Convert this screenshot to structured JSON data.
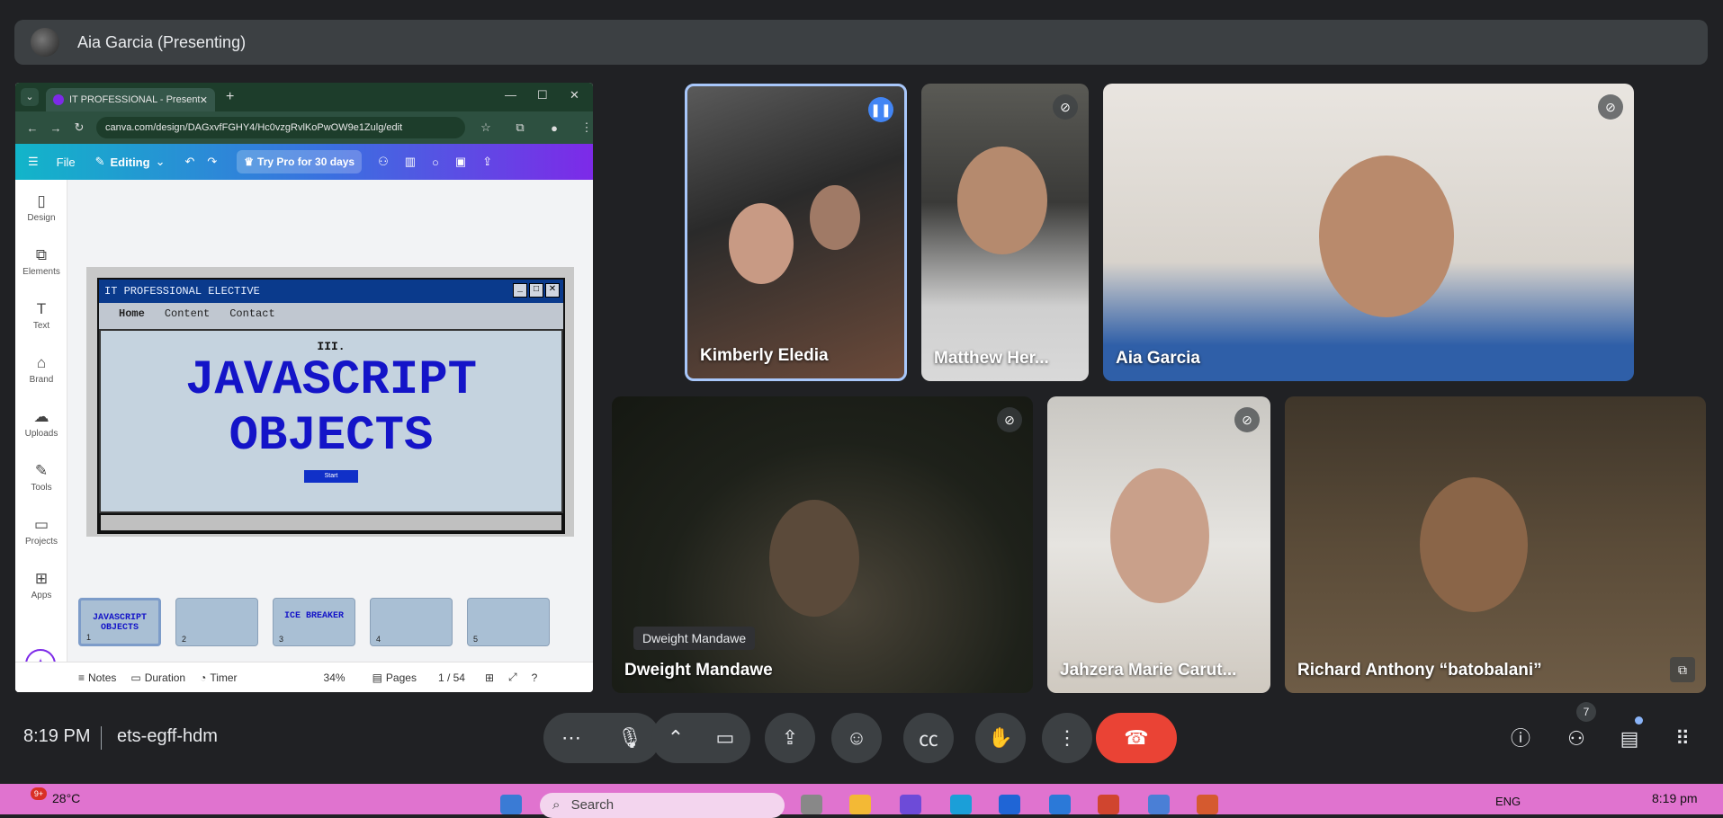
{
  "header": {
    "presenter_title": "Aia Garcia (Presenting)"
  },
  "shared_screen": {
    "browser": {
      "tab_title": "IT PROFESSIONAL - Presentatio",
      "url": "canva.com/design/DAGxvfFGHY4/Hc0vzgRvlKoPwOW9e1Zulg/edit"
    },
    "canva": {
      "file_label": "File",
      "editing_label": "Editing",
      "pro_button": "Try Pro for 30 days",
      "sidebar": [
        "Design",
        "Elements",
        "Text",
        "Brand",
        "Uploads",
        "Tools",
        "Projects",
        "Apps"
      ],
      "slide": {
        "window_title": "IT PROFESSIONAL ELECTIVE",
        "menu": [
          "Home",
          "Content",
          "Contact"
        ],
        "number": "III.",
        "line1": "JAVASCRIPT",
        "line2": "OBJECTS",
        "start": "Start"
      },
      "thumbnails": [
        {
          "n": "1",
          "text": "JAVASCRIPT OBJECTS"
        },
        {
          "n": "2",
          "text": ""
        },
        {
          "n": "3",
          "text": "ICE BREAKER"
        },
        {
          "n": "4",
          "text": ""
        },
        {
          "n": "5",
          "text": ""
        }
      ],
      "bottom": {
        "notes": "Notes",
        "duration": "Duration",
        "timer": "Timer",
        "zoom": "34%",
        "pages": "Pages",
        "page_count": "1 / 54"
      }
    }
  },
  "participants": [
    {
      "name": "Kimberly Eledia",
      "speaking": true
    },
    {
      "name": "Matthew Her...",
      "muted": true
    },
    {
      "name": "Aia Garcia",
      "muted": true
    },
    {
      "name": "Dweight Mandawe",
      "chip": "Dweight Mandawe",
      "muted": true
    },
    {
      "name": "Jahzera Marie Carut...",
      "muted": true
    },
    {
      "name": "Richard Anthony “batobalani”"
    }
  ],
  "controls": {
    "time": "8:19 PM",
    "meeting_code": "ets-egff-hdm",
    "people_count": "7"
  },
  "taskbar": {
    "weather_badge": "9+",
    "temperature": "28°C",
    "search_placeholder": "Search",
    "language": "ENG",
    "time": "8:19 pm"
  },
  "colors": {
    "leave": "#ea4335",
    "active_border": "#a8c7fa",
    "taskbar": "#e073cf"
  }
}
